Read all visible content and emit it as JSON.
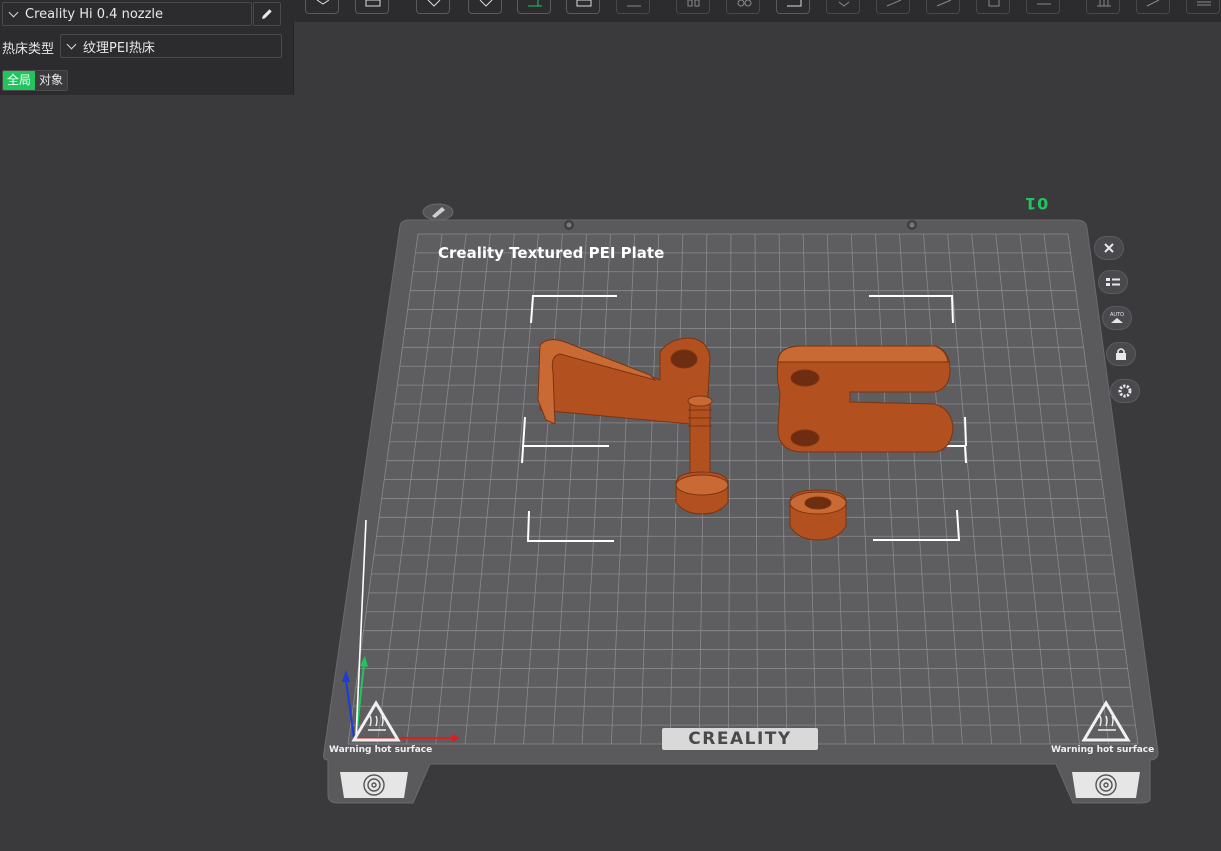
{
  "left_panel": {
    "nozzle": "Creality Hi 0.4 nozzle",
    "bed_type_label": "热床类型",
    "bed_type": "纹理PEI热床",
    "scope_tabs": [
      "全局",
      "对象"
    ]
  },
  "plate": {
    "number": "01",
    "title": "Creality Textured PEI Plate",
    "warning_left": "Warning hot surface",
    "warning_right": "Warning hot surface",
    "brand": "CREALITY"
  },
  "colors": {
    "accent": "#21c55d",
    "model": "#b3501f",
    "bed": "#5a5a5c",
    "background": "#3a3a3d"
  },
  "icons": [
    "chevron-down-icon",
    "pencil-icon",
    "close-icon",
    "list-icon",
    "auto-arrange-icon",
    "lock-icon",
    "gear-icon"
  ]
}
